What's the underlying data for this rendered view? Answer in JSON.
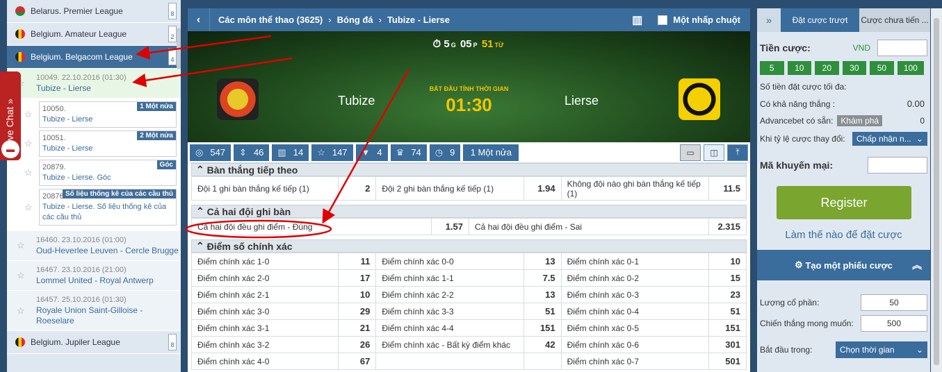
{
  "sidebar": {
    "leagues_top": [
      {
        "name": "Belarus. Premier League",
        "count": "8",
        "flag": "by"
      },
      {
        "name": "Belgium. Amateur League",
        "count": "2",
        "flag": "be"
      },
      {
        "name": "Belgium. Belgacom League",
        "count": "4",
        "flag": "be"
      }
    ],
    "selected_match": {
      "date": "10049. 22.10.2016 (01:30)",
      "teams": "Tubize - Lierse"
    },
    "sub_items": [
      {
        "date": "10050.",
        "teams": "Tubize - Lierse",
        "tag": "1 Một nửa"
      },
      {
        "date": "10051.",
        "teams": "Tubize - Lierse",
        "tag": "2 Một nửa"
      },
      {
        "date": "20879.",
        "teams": "Tubize - Lierse. Góc",
        "tag": "Góc"
      },
      {
        "date": "20876.",
        "teams": "Tubize - Lierse. Số liệu thống kê của các cầu thủ",
        "tag": "Số liệu thống kê của các cầu thủ"
      }
    ],
    "matches": [
      {
        "date": "16460. 23.10.2016 (01:00)",
        "teams": "Oud-Heverlee Leuven - Cercle Brugge"
      },
      {
        "date": "16467. 23.10.2016 (21:00)",
        "teams": "Lommel United - Royal Antwerp"
      },
      {
        "date": "16457. 25.10.2016 (01:30)",
        "teams": "Royale Union Saint-Gilloise - Roeselare"
      }
    ],
    "league_bottom": {
      "name": "Belgium. Jupiler League",
      "count": "8"
    },
    "live_chat": "Live Chat »"
  },
  "header": {
    "crumbs": [
      "Các môn thể thao (3625)",
      "Bóng đá",
      "Tubize - Lierse"
    ],
    "one_click": "Một nhấp chuột"
  },
  "scoreboard": {
    "hours": "5",
    "h_unit": "G",
    "minutes": "05",
    "m_unit": "P",
    "seconds": "51",
    "s_unit": "TỪ",
    "team1": "Tubize",
    "team2": "Lierse",
    "start_label": "BẮT ĐẦU TÍNH THỜI GIAN",
    "start_time": "01:30"
  },
  "market_tabs": [
    {
      "icon": "target-icon",
      "glyph": "◎",
      "value": "547"
    },
    {
      "icon": "updown-icon",
      "glyph": "⇕",
      "value": "46"
    },
    {
      "icon": "bars-icon",
      "glyph": "▥",
      "value": "14"
    },
    {
      "icon": "star-icon",
      "glyph": "☆",
      "value": "147"
    },
    {
      "icon": "shirt-icon",
      "glyph": "👕",
      "value": "4"
    },
    {
      "icon": "trophy-icon",
      "glyph": "♛",
      "value": "74"
    },
    {
      "icon": "stopwatch-icon",
      "glyph": "◷",
      "value": "9"
    },
    {
      "icon": "",
      "glyph": "",
      "value": "1 Một nửa"
    }
  ],
  "sections": {
    "next_goal": {
      "title": "Bàn thắng tiếp theo",
      "row": [
        [
          "Đội 1 ghi bàn thắng kế tiếp (1)",
          "2"
        ],
        [
          "Đội 2 ghi bàn thắng kế tiếp (1)",
          "1.94"
        ],
        [
          "Không đội nào ghi bàn thắng kế tiếp (1)",
          "11.5"
        ]
      ]
    },
    "btts": {
      "title": "Cả hai đội ghi bàn",
      "row": [
        [
          "Cả hai đội đều ghi điểm - Đúng",
          "1.57"
        ],
        [
          "Cả hai đội đều ghi điểm - Sai",
          "2.315"
        ]
      ]
    },
    "correct_score": {
      "title": "Điểm số chính xác",
      "rows": [
        [
          [
            "Điểm chính xác 1-0",
            "11"
          ],
          [
            "Điểm chính xác 0-0",
            "13"
          ],
          [
            "Điểm chính xác 0-1",
            "10"
          ]
        ],
        [
          [
            "Điểm chính xác 2-0",
            "17"
          ],
          [
            "Điểm chính xác 1-1",
            "7.5"
          ],
          [
            "Điểm chính xác 0-2",
            "15"
          ]
        ],
        [
          [
            "Điểm chính xác 2-1",
            "10"
          ],
          [
            "Điểm chính xác 2-2",
            "13"
          ],
          [
            "Điểm chính xác 0-3",
            "23"
          ]
        ],
        [
          [
            "Điểm chính xác 3-0",
            "29"
          ],
          [
            "Điểm chính xác 3-3",
            "51"
          ],
          [
            "Điểm chính xác 0-4",
            "51"
          ]
        ],
        [
          [
            "Điểm chính xác 3-1",
            "21"
          ],
          [
            "Điểm chính xác 4-4",
            "151"
          ],
          [
            "Điểm chính xác 0-5",
            "151"
          ]
        ],
        [
          [
            "Điểm chính xác 3-2",
            "26"
          ],
          [
            "Điểm chính xác - Bất kỳ điểm khác",
            "42"
          ],
          [
            "Điểm chính xác 0-6",
            "301"
          ]
        ],
        [
          [
            "Điểm chính xác 4-0",
            "67"
          ],
          [
            "",
            ""
          ],
          [
            "Điểm chính xác 0-7",
            "501"
          ]
        ]
      ]
    }
  },
  "betslip": {
    "tab_active": "Đặt cược trượt",
    "tab_other": "Cược chưa tiến ...",
    "stake_label": "Tiền cược:",
    "currency": "VND",
    "stakes": [
      "5",
      "10",
      "20",
      "30",
      "50",
      "100"
    ],
    "max_label": "Số tiền đặt cược tối đa:",
    "win_label": "Có khả năng thắng :",
    "win_value": "0.00",
    "advance_label": "Advancebet có sẵn:",
    "explore": "Khám phá",
    "advance_value": "0",
    "odds_change_label": "Khi tỷ lệ cược thay đổi:",
    "odds_change_value": "Chấp nhận n...",
    "promo_label": "Mã khuyến mại:",
    "register": "Register",
    "howto": "Làm thế nào để đặt cược",
    "ticket_title": "Tạo một phiếu cược",
    "shares_label": "Lượng cổ phần:",
    "shares_value": "50",
    "desired_label": "Chiến thắng mong muốn:",
    "desired_value": "500",
    "start_label": "Bắt đầu trong:",
    "start_value": "Chọn thời gian"
  },
  "colors": {
    "primary": "#3a6c9c",
    "accent_yellow": "#f2c500",
    "green": "#2f8f3c",
    "annotation_red": "#e00000"
  }
}
